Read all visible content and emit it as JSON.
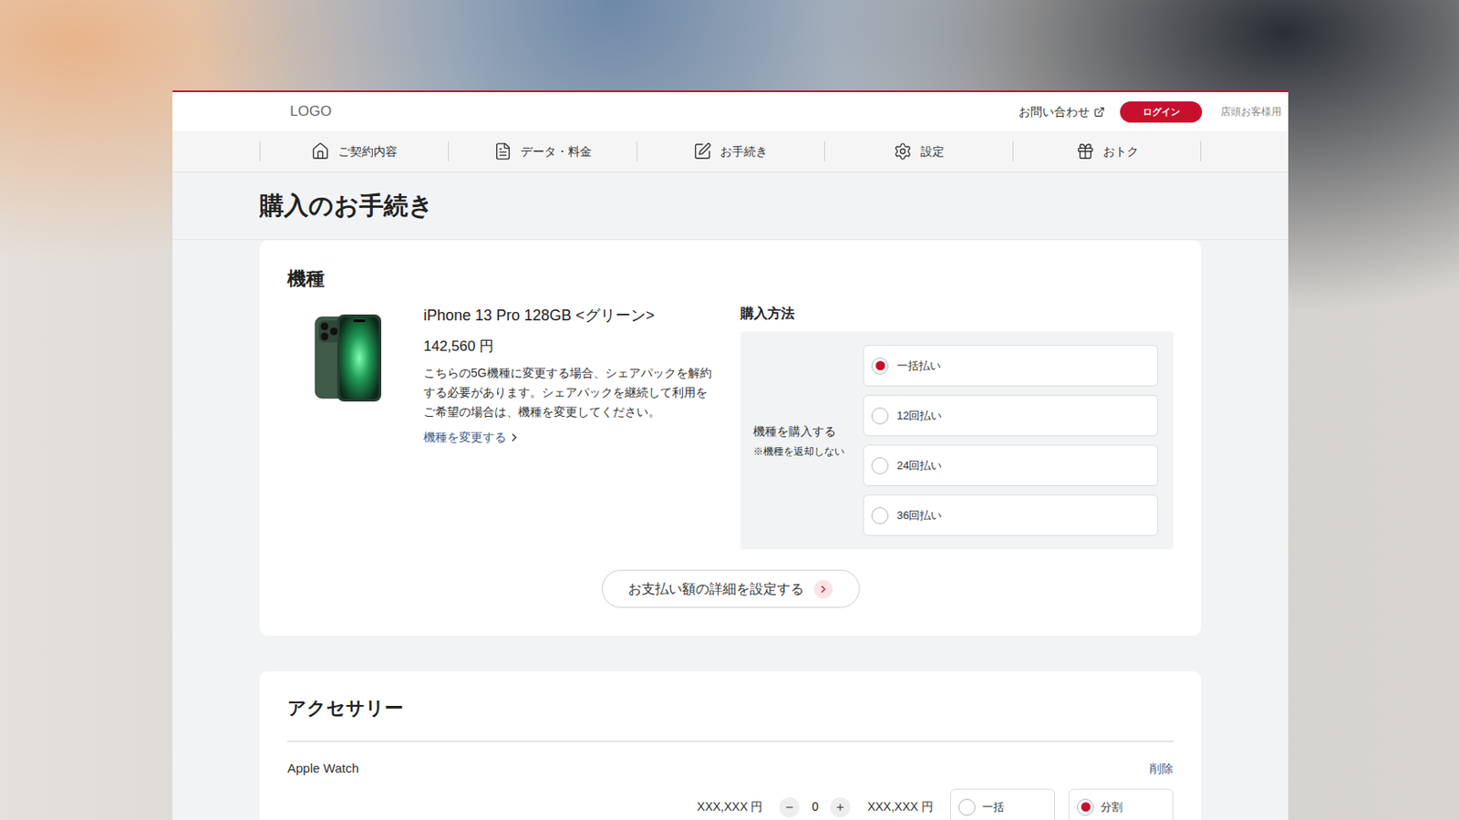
{
  "header": {
    "logo": "LOGO",
    "contact": "お問い合わせ",
    "login": "ログイン",
    "store": "店頭お客様用"
  },
  "nav": [
    {
      "label": "ご契約内容",
      "icon": "home"
    },
    {
      "label": "データ・料金",
      "icon": "data"
    },
    {
      "label": "お手続き",
      "icon": "procedure"
    },
    {
      "label": "設定",
      "icon": "settings"
    },
    {
      "label": "おトク",
      "icon": "gift"
    }
  ],
  "page_title": "購入のお手続き",
  "device_section": {
    "heading": "機種",
    "product": {
      "name": "iPhone 13 Pro 128GB <グリーン>",
      "price": "142,560 円",
      "description": "こちらの5G機種に変更する場合、シェアパックを解約する必要があります。シェアパックを継続して利用をご希望の場合は、機種を変更してください。",
      "change_link": "機種を変更する"
    },
    "purchase": {
      "heading": "購入方法",
      "label": "機種を購入する",
      "note": "※機種を返却しない",
      "options": [
        {
          "label": "一括払い",
          "selected": true
        },
        {
          "label": "12回払い",
          "selected": false
        },
        {
          "label": "24回払い",
          "selected": false
        },
        {
          "label": "36回払い",
          "selected": false
        }
      ]
    },
    "detail_button": "お支払い額の詳細を設定する"
  },
  "accessory_section": {
    "heading": "アクセサリー",
    "items": [
      {
        "name": "Apple Watch",
        "delete": "削除",
        "price": "XXX,XXX 円",
        "quantity": "0",
        "total": "XXX,XXX 円",
        "options": [
          {
            "label": "一括",
            "selected": false
          },
          {
            "label": "分割",
            "selected": true
          }
        ]
      }
    ]
  }
}
